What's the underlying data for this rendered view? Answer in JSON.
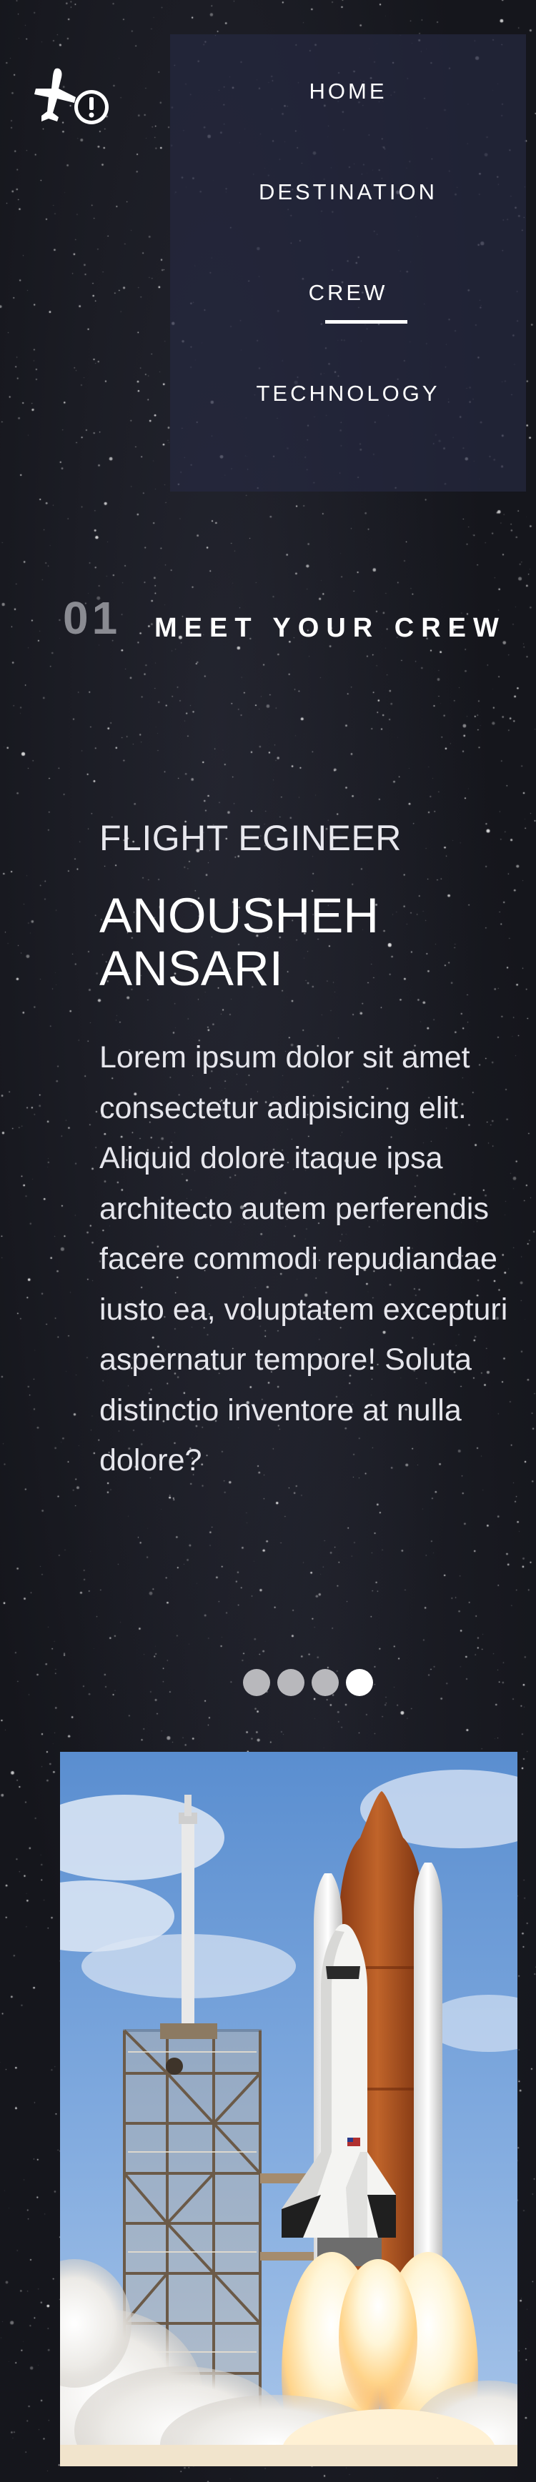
{
  "logo": {
    "icon": "airplane-alert-icon"
  },
  "nav": {
    "items": [
      {
        "label": "HOME"
      },
      {
        "label": "DESTINATION"
      },
      {
        "label": "CREW",
        "active": true
      },
      {
        "label": "TECHNOLOGY"
      }
    ]
  },
  "section": {
    "number": "01",
    "title": "MEET YOUR CREW"
  },
  "crew": {
    "role": "FLIGHT EGINEER",
    "name": "ANOUSHEH ANSARI",
    "bio": "Lorem ipsum dolor sit amet consectetur adipisicing elit. Aliquid dolore itaque ipsa architecto autem perferendis facere commodi repudiandae iusto ea, voluptatem excepturi aspernatur tempore! Soluta distinctio inventore at nulla dolore?"
  },
  "pagination": {
    "count": 4,
    "active_index": 3
  },
  "colors": {
    "background": "#15161c",
    "nav_panel": "#26283f",
    "section_number": "#8a8b92",
    "dot_inactive": "#b8b8bc",
    "dot_active": "#ffffff"
  }
}
